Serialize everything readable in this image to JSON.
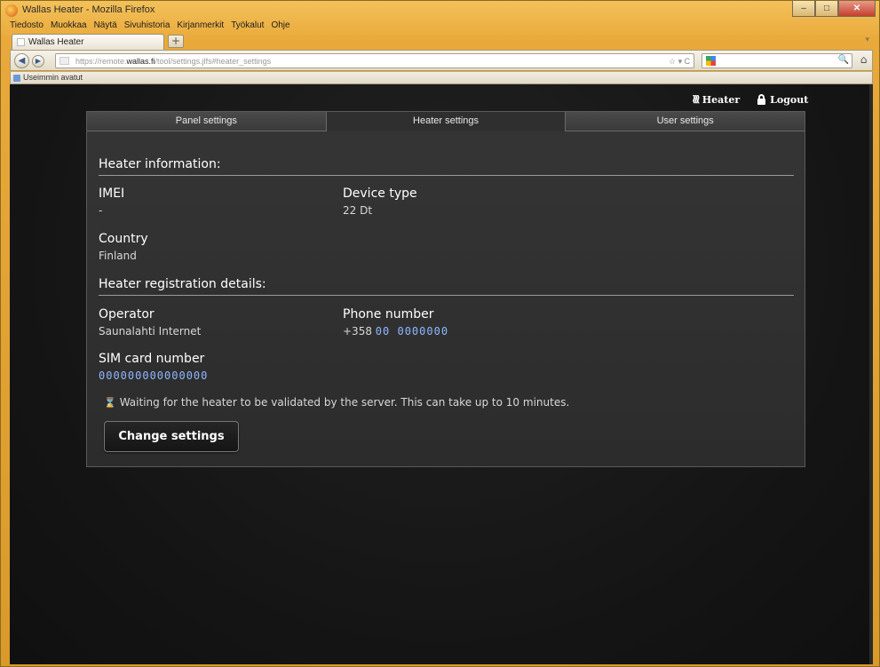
{
  "window": {
    "title": "Wallas Heater - Mozilla Firefox",
    "controls": {
      "minimize": "–",
      "maximize": "□",
      "close": "✕"
    }
  },
  "menu": [
    "Tiedosto",
    "Muokkaa",
    "Näytä",
    "Sivuhistoria",
    "Kirjanmerkit",
    "Työkalut",
    "Ohje"
  ],
  "browser_tab": {
    "label": "Wallas Heater",
    "new_tab": "+"
  },
  "navbar": {
    "back": "◀",
    "forward": "▶",
    "url_prefix": "https://remote.",
    "url_domain": "wallas.fi",
    "url_suffix": "/tool/settings.jlfs#heater_settings",
    "url_icons": "☆ ▾ C",
    "home": "⌂",
    "search_go": "🔍"
  },
  "bookmarks": {
    "label": "Useimmin avatut"
  },
  "top_links": {
    "heater_label": "Heater",
    "heater_icon": "≀≀≀",
    "logout_label": "Logout"
  },
  "tabs": [
    "Panel settings",
    "Heater settings",
    "User settings"
  ],
  "heater_info": {
    "heading": "Heater information:",
    "imei_label": "IMEI",
    "imei_value": "-",
    "device_type_label": "Device type",
    "device_type_value": "22 Dt",
    "country_label": "Country",
    "country_value": "Finland"
  },
  "registration": {
    "heading": "Heater registration details:",
    "operator_label": "Operator",
    "operator_value": "Saunalahti Internet",
    "phone_label": "Phone number",
    "phone_prefix": "+358",
    "phone_value": "00 0000000",
    "sim_label": "SIM card number",
    "sim_value": "000000000000000"
  },
  "status": {
    "icon": "⌛",
    "message": "Waiting for the heater to be validated by the server. This can take up to 10 minutes."
  },
  "actions": {
    "change_settings": "Change settings"
  },
  "colors": {
    "accent_blue": "#8fb7ff",
    "frame": "#e9a93a",
    "page_bg": "#141414"
  }
}
